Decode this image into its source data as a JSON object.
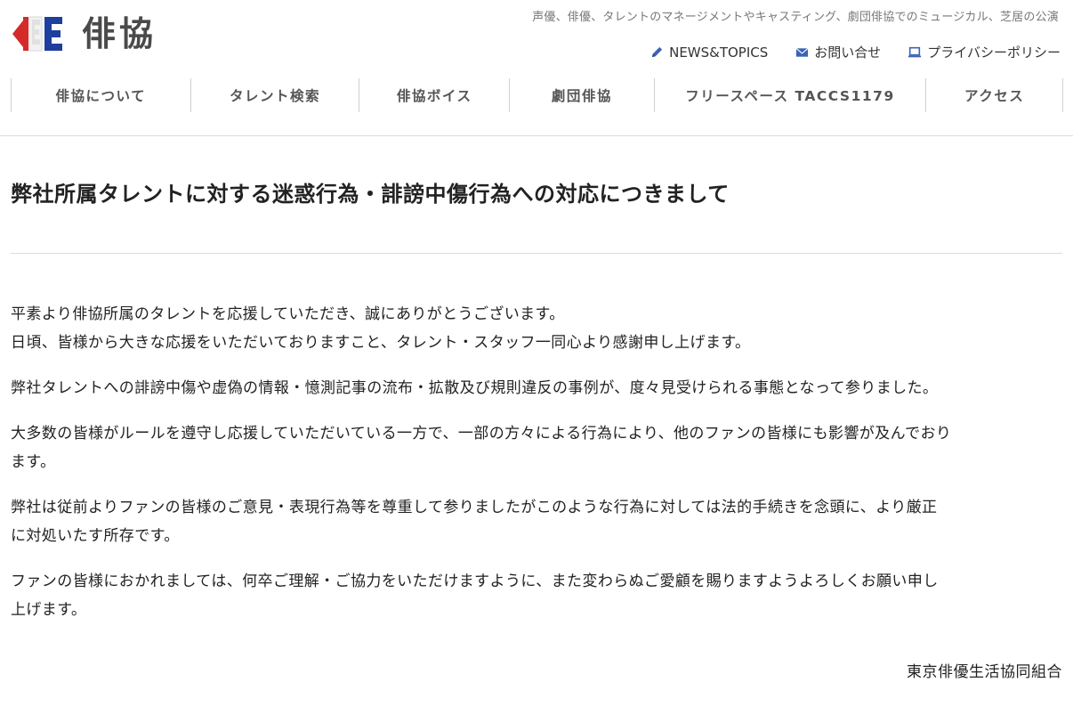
{
  "header": {
    "logo_text": "俳協",
    "tagline": "声優、俳優、タレントのマネージメントやキャスティング、劇団俳協でのミュージカル、芝居の公演",
    "util_links": [
      {
        "label": "NEWS&TOPICS",
        "icon": "pencil-icon"
      },
      {
        "label": "お問い合せ",
        "icon": "mail-icon"
      },
      {
        "label": "プライバシーポリシー",
        "icon": "laptop-icon"
      }
    ],
    "nav": [
      {
        "label": "俳協について"
      },
      {
        "label": "タレント検索"
      },
      {
        "label": "俳協ボイス"
      },
      {
        "label": "劇団俳協"
      },
      {
        "label": "フリースペース TACCS1179"
      },
      {
        "label": "アクセス"
      }
    ]
  },
  "main": {
    "title": "弊社所属タレントに対する迷惑行為・誹謗中傷行為への対応につきまして",
    "paragraphs": [
      {
        "line1": "平素より俳協所属のタレントを応援していただき、誠にありがとうございます。",
        "line2": "日頃、皆様から大きな応援をいただいておりますこと、タレント・スタッフ一同心より感謝申し上げます。"
      },
      {
        "line1": "弊社タレントへの誹謗中傷や虚偽の情報・憶測記事の流布・拡散及び規則違反の事例が、度々見受けられる事態となって参りました。",
        "line2": ""
      },
      {
        "line1": "大多数の皆様がルールを遵守し応援していただいている一方で、一部の方々による行為により、他のファンの皆様にも影響が及んでおり",
        "line2": "ます。"
      },
      {
        "line1": "弊社は従前よりファンの皆様のご意見・表現行為等を尊重して参りましたがこのような行為に対しては法的手続きを念頭に、より厳正",
        "line2": "に対処いたす所存です。"
      },
      {
        "line1": "ファンの皆様におかれましては、何卒ご理解・ご協力をいただけますように、また変わらぬご愛顧を賜りますようよろしくお願い申し",
        "line2": "上げます。"
      }
    ],
    "signature": "東京俳優生活協同組合"
  },
  "colors": {
    "logo_red": "#d42a2a",
    "logo_blue": "#1e3f9c",
    "icon_blue": "#3b63b8",
    "nav_text": "#555555",
    "divider": "#dcdcdc"
  }
}
